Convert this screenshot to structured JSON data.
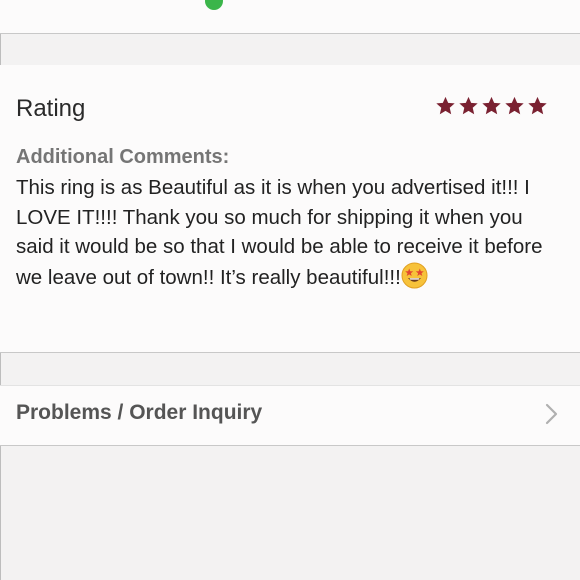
{
  "rating": {
    "title": "Rating",
    "value": 5,
    "max": 5,
    "star_color": "#7a2131",
    "comments_label": "Additional Comments:",
    "comments_text": "This ring is as Beautiful as it is when you advertised it!!! I LOVE IT!!!! Thank you so much for shipping it when you said it would be so that I would be able to receive it before we leave out of town!! It’s really beautiful!!!",
    "emoji": "star-struck-emoji"
  },
  "inquiry": {
    "label": "Problems / Order Inquiry",
    "icon": "chevron-right-icon"
  },
  "colors": {
    "status_dot": "#3bb54a",
    "background": "#f3f2f2",
    "card": "#fcfbfb"
  }
}
